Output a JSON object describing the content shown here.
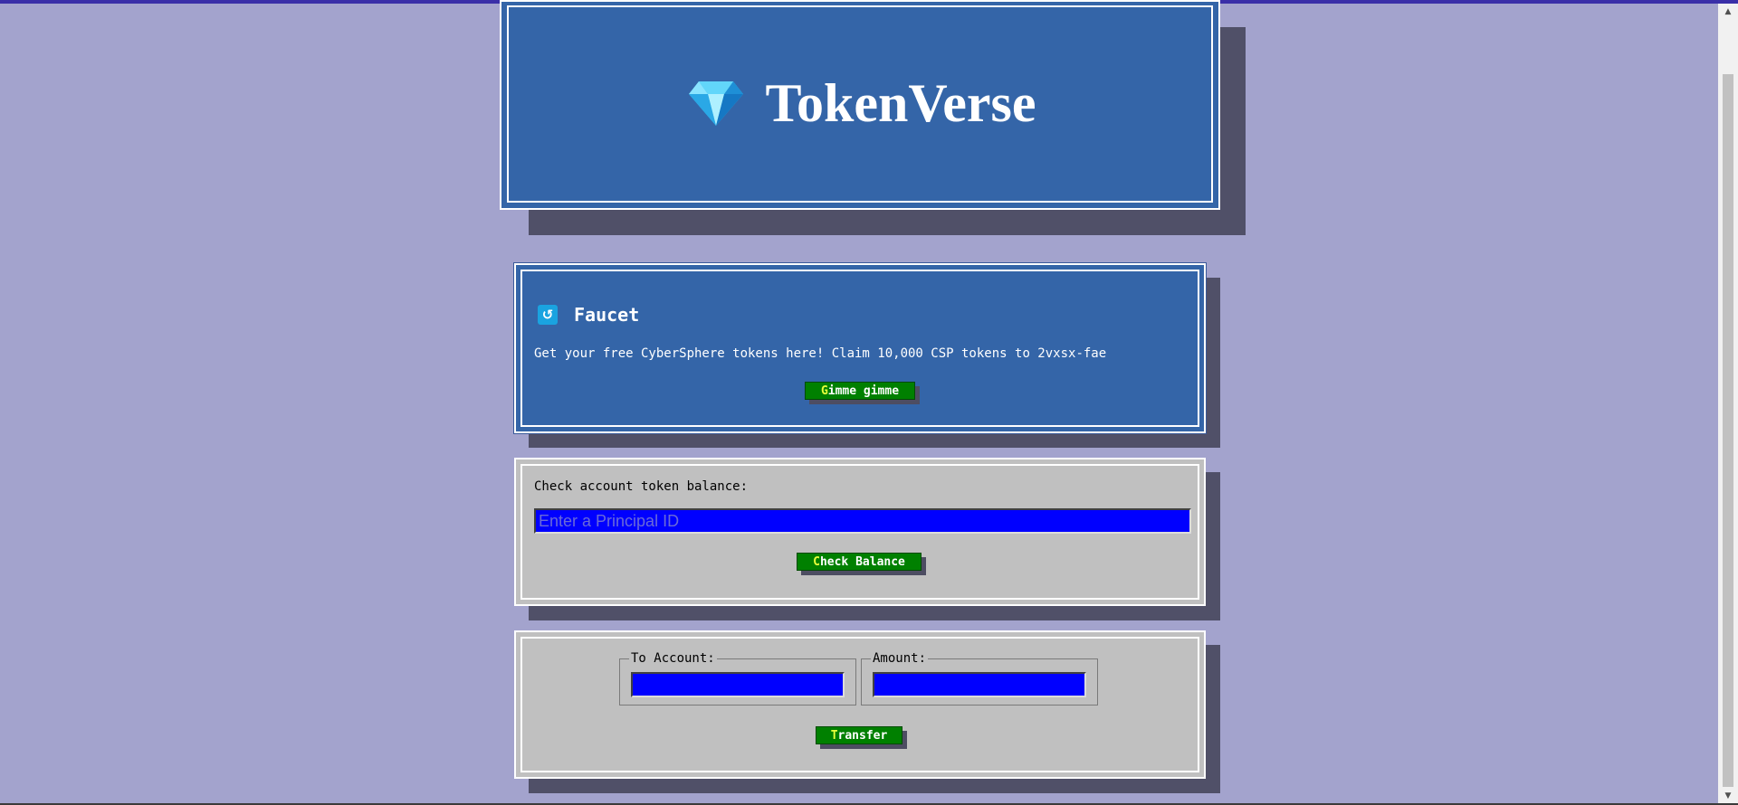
{
  "header": {
    "title": "TokenVerse",
    "logo_icon": "gem-icon"
  },
  "faucet": {
    "title": "Faucet",
    "icon": "faucet-icon",
    "description": "Get your free CyberSphere tokens here! Claim 10,000 CSP tokens to 2vxsx-fae",
    "button_first": "G",
    "button_rest": "imme gimme"
  },
  "balance": {
    "label": "Check account token balance:",
    "input_placeholder": "Enter a Principal ID",
    "input_value": "",
    "button_first": "C",
    "button_rest": "heck Balance"
  },
  "transfer": {
    "to_label": "To Account:",
    "to_value": "",
    "amount_label": "Amount:",
    "amount_value": "",
    "button_first": "T",
    "button_rest": "ransfer"
  },
  "colors": {
    "page_bg": "#a3a3cd",
    "panel_blue": "#3465a8",
    "panel_grey": "#c0c0c0",
    "button_green": "#008000",
    "input_blue": "#0000ff",
    "button_first_letter": "#e8ff3a"
  }
}
